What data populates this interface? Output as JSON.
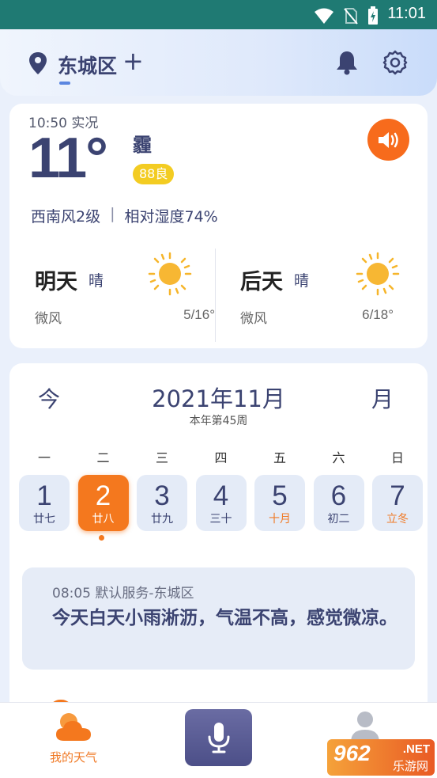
{
  "status_bar": {
    "time": "11:01"
  },
  "header": {
    "location": "东城区",
    "add_symbol": "+"
  },
  "current": {
    "observed": "10:50 实况",
    "temperature": "11°",
    "condition": "霾",
    "aqi": "88良",
    "wind": "西南风2级",
    "separator": "|",
    "humidity": "相对湿度74%"
  },
  "forecast": [
    {
      "day": "明天",
      "condition": "晴",
      "wind": "微风",
      "range": "5/16°",
      "icon": "sun-icon"
    },
    {
      "day": "后天",
      "condition": "晴",
      "wind": "微风",
      "range": "6/18°",
      "icon": "sun-icon"
    }
  ],
  "calendar": {
    "today_button": "今",
    "title": "2021年11月",
    "week_of_year": "本年第45周",
    "month_button": "月",
    "weekdays": [
      "一",
      "二",
      "三",
      "四",
      "五",
      "六",
      "日"
    ],
    "days": [
      {
        "num": "1",
        "lunar": "廿七"
      },
      {
        "num": "2",
        "lunar": "廿八"
      },
      {
        "num": "3",
        "lunar": "廿九"
      },
      {
        "num": "4",
        "lunar": "三十"
      },
      {
        "num": "5",
        "lunar": "十月"
      },
      {
        "num": "6",
        "lunar": "初二"
      },
      {
        "num": "7",
        "lunar": "立冬"
      }
    ],
    "selected_index": 1
  },
  "note": {
    "meta": "08:05 默认服务-东城区",
    "text": "今天白天小雨淅沥，气温不高，感觉微凉。"
  },
  "bottom_nav": {
    "weather_label": "我的天气"
  },
  "watermark": {
    "brand": "962",
    "suffix": ".NET",
    "site": "乐游网"
  },
  "colors": {
    "accent": "#f4781e",
    "primary_text": "#3b4371",
    "aqi_badge": "#f3cc22",
    "status_bar": "#1f7a73"
  }
}
